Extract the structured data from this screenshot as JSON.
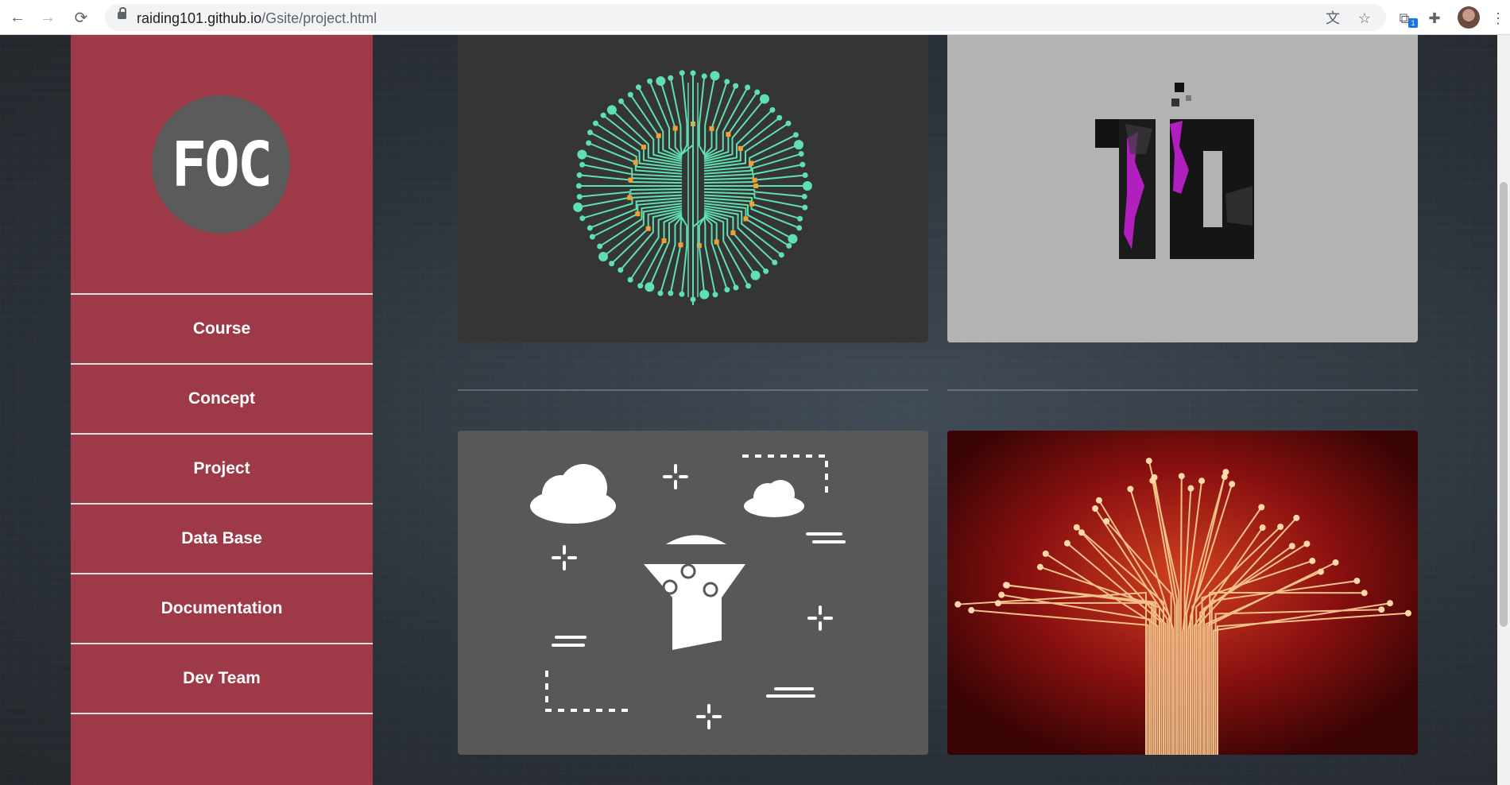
{
  "browser": {
    "url_host": "raiding101.github.io",
    "url_path": "/Gsite/project.html",
    "extension_badge": "1"
  },
  "sidebar": {
    "logo_text": "FOC",
    "items": [
      {
        "label": "Course"
      },
      {
        "label": "Concept"
      },
      {
        "label": "Project"
      },
      {
        "label": "Data Base"
      },
      {
        "label": "Documentation"
      },
      {
        "label": "Dev Team"
      }
    ]
  },
  "colors": {
    "sidebar": "#9e3a47",
    "accent_teal": "#5fe0b0",
    "accent_orange": "#f0a030",
    "magenta": "#b21fbf"
  },
  "cards": [
    {
      "image": "circuit-brain-icon"
    },
    {
      "image": "tio-logo-icon"
    },
    {
      "image": "data-funnel-cloud-icon"
    },
    {
      "image": "red-circuit-tree-icon"
    }
  ]
}
